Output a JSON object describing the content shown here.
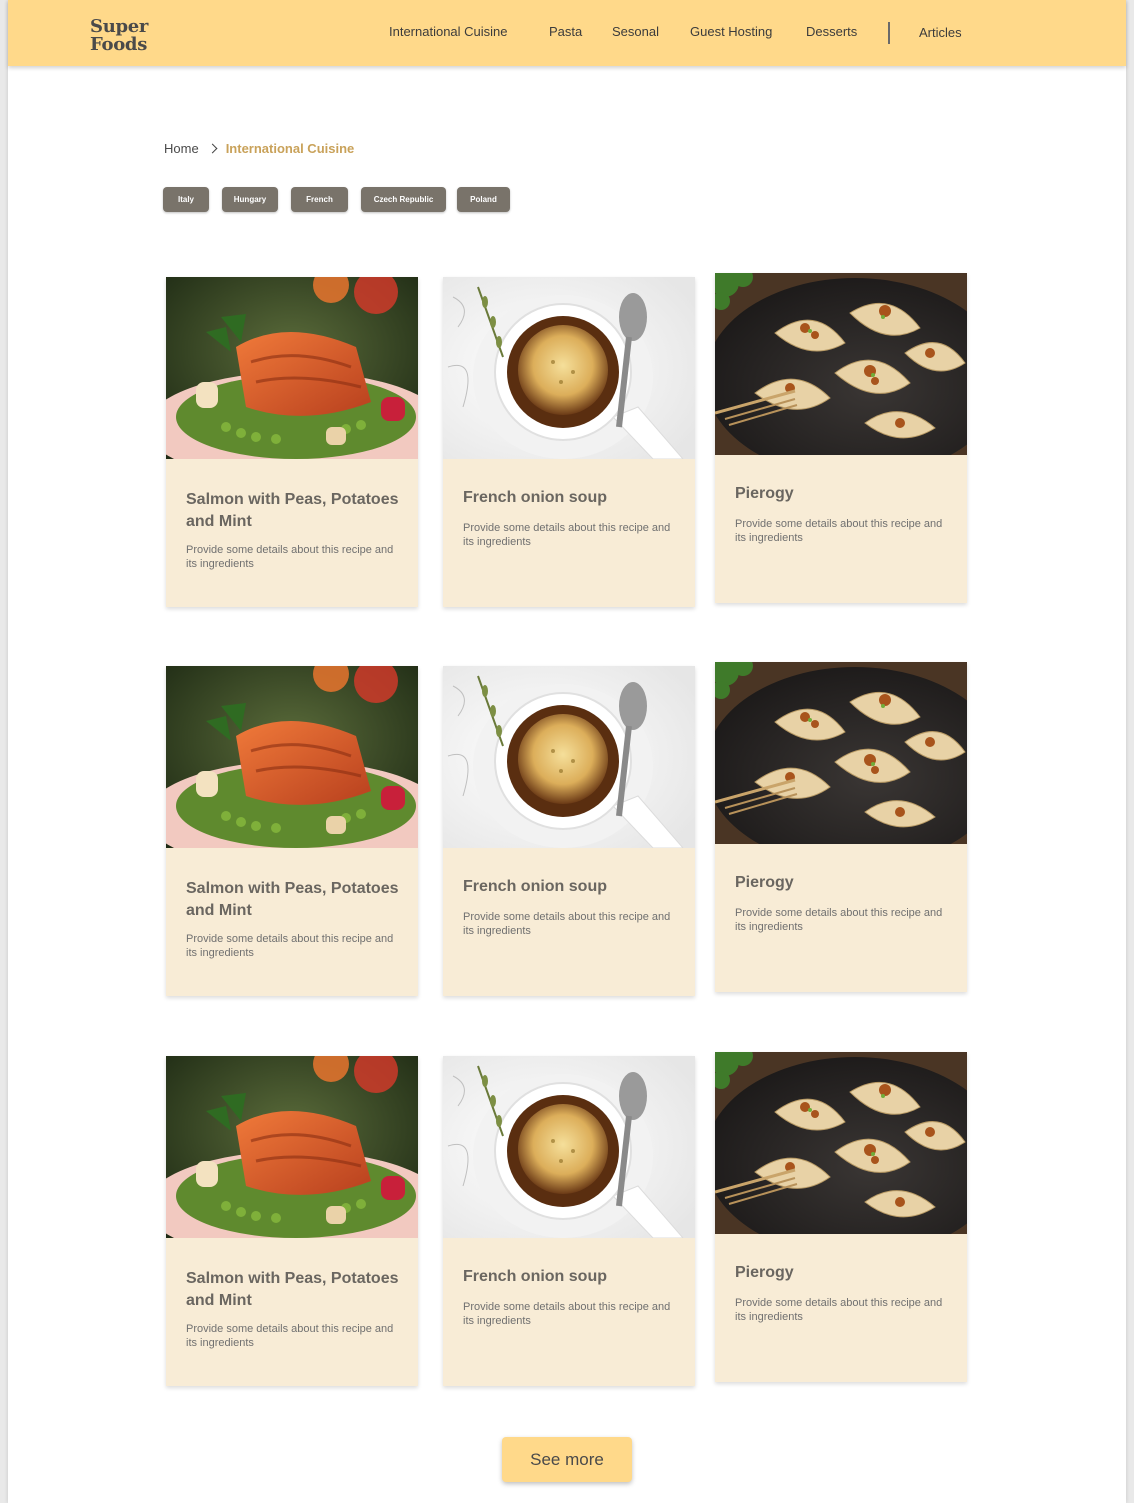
{
  "header": {
    "logo_line1": "Super",
    "logo_line2": "Foods",
    "nav": [
      "International Cuisine",
      "Pasta",
      "Sesonal",
      "Guest Hosting",
      "Desserts",
      "Articles"
    ]
  },
  "breadcrumb": {
    "home": "Home",
    "current": "International Cuisine"
  },
  "tags": [
    "Italy",
    "Hungary",
    "French",
    "Czech Republic",
    "Poland"
  ],
  "recipes": [
    {
      "title": "Salmon with Peas, Potatoes and Mint",
      "desc": "Provide some details about this recipe and its ingredients",
      "image": "salmon"
    },
    {
      "title": "French onion soup",
      "desc": "Provide some details about this recipe and its ingredients",
      "image": "onion-soup"
    },
    {
      "title": "Pierogy",
      "desc": "Provide some details about this recipe and its ingredients",
      "image": "pierogy"
    },
    {
      "title": "Salmon with Peas, Potatoes and Mint",
      "desc": "Provide some details about this recipe and its ingredients",
      "image": "salmon"
    },
    {
      "title": "French onion soup",
      "desc": "Provide some details about this recipe and its ingredients",
      "image": "onion-soup"
    },
    {
      "title": "Pierogy",
      "desc": "Provide some details about this recipe and its ingredients",
      "image": "pierogy"
    },
    {
      "title": "Salmon with Peas, Potatoes and Mint",
      "desc": "Provide some details about this recipe and its ingredients",
      "image": "salmon"
    },
    {
      "title": "French onion soup",
      "desc": "Provide some details about this recipe and its ingredients",
      "image": "onion-soup"
    },
    {
      "title": "Pierogy",
      "desc": "Provide some details about this recipe and its ingredients",
      "image": "pierogy"
    }
  ],
  "see_more_label": "See more",
  "colors": {
    "header_bg": "#ffd98a",
    "card_bg": "#f8ecd6",
    "tag_bg": "#79736a",
    "breadcrumb_active": "#c9a25a"
  }
}
